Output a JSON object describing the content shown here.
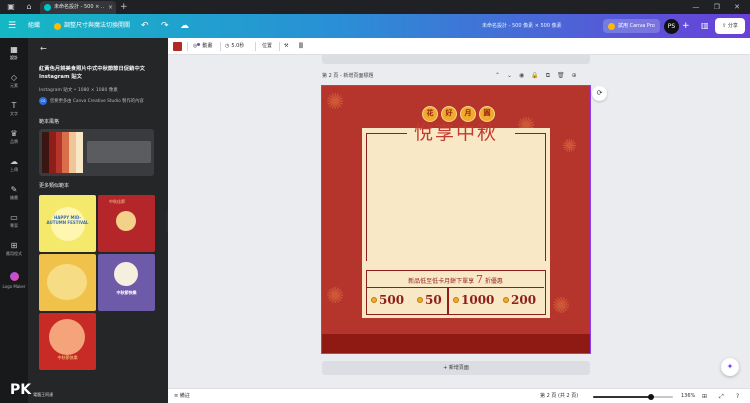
{
  "browser": {
    "tab_title": "未命名設計 - 500 × ...",
    "close_glyph": "×",
    "new_tab_glyph": "+",
    "window_controls": "— ❐ ✕"
  },
  "topbar": {
    "home_label": "組織",
    "resize_label": "調整尺寸與魔法切換開關",
    "doc_title": "未命名設計 - 500 像素 × 500 像素",
    "try_pro_label": "試用 Canva Pro",
    "avatar_initials": "PS",
    "share_label": "分享",
    "menu_icon": "hamburger-menu-icon",
    "brand_color": "#14b8c4"
  },
  "rail": {
    "items": [
      {
        "label": "設計",
        "icon": "layout-icon"
      },
      {
        "label": "元素",
        "icon": "shapes-icon"
      },
      {
        "label": "文字",
        "icon": "text-icon"
      },
      {
        "label": "品牌",
        "icon": "brand-icon"
      },
      {
        "label": "上傳",
        "icon": "upload-icon"
      },
      {
        "label": "繪畫",
        "icon": "draw-icon"
      },
      {
        "label": "專案",
        "icon": "folder-icon"
      },
      {
        "label": "應用程式",
        "icon": "apps-icon"
      },
      {
        "label": "Logo Maker",
        "icon": "logo-maker-icon"
      }
    ]
  },
  "panel": {
    "title": "紅黃色月餅美食照片中式中秋節節日促銷中文Instagram 貼文",
    "meta": "Instagram 貼文 • 1080 × 1080 像素",
    "author_badge": "CS",
    "author": "您要更多由 Canva Creative Studio 製作的內容",
    "style_heading": "範本風格",
    "more_heading": "更多類似範本",
    "style_stripes": [
      "#3a1512",
      "#8f1e18",
      "#b5342c",
      "#d86f4a",
      "#efc59a",
      "#f8e8c6"
    ],
    "thumbs": [
      {
        "text": "HAPPY MID-AUTUMN FESTIVAL",
        "bg": "#f4e96a",
        "fg": "#3a6fb0"
      },
      {
        "text": "中秋佳節",
        "bg": "#b5262a",
        "fg": "#f4d18a"
      },
      {
        "text": "",
        "bg": "#f1c24b",
        "fg": "#7a4a10"
      },
      {
        "text": "中秋節快樂",
        "bg": "#6d5aa8",
        "fg": "#ffffff"
      },
      {
        "text": "中秋節快樂",
        "bg": "#c82b25",
        "fg": "#ffd98a"
      }
    ]
  },
  "toolbar": {
    "swatch_color": "#b22a24",
    "animate_label": "動畫",
    "duration_label": "5.0秒",
    "position_label": "位置"
  },
  "canvas": {
    "page_label": "第 2 頁 - 新增頁面標題",
    "badges": [
      "花",
      "好",
      "月",
      "圓"
    ],
    "headline": "悅享中秋",
    "promo_prefix": "新品低至低卡月餅下單享",
    "promo_big": "7",
    "promo_suffix": "折優惠",
    "amounts": [
      "500",
      "50",
      "1000",
      "200"
    ],
    "bg_color": "#b5342c",
    "card_color": "#f8e8c6",
    "accent": "#8f1e18"
  },
  "workspace": {
    "add_page_label": "+ 新增頁面"
  },
  "bottombar": {
    "notes_label": "備註",
    "page_info": "第 2 頁 (共 2 頁)",
    "zoom_label": "136%",
    "zoom_level": 0.72
  },
  "watermark": {
    "mark": "PK",
    "text": "電腦王阿達"
  }
}
